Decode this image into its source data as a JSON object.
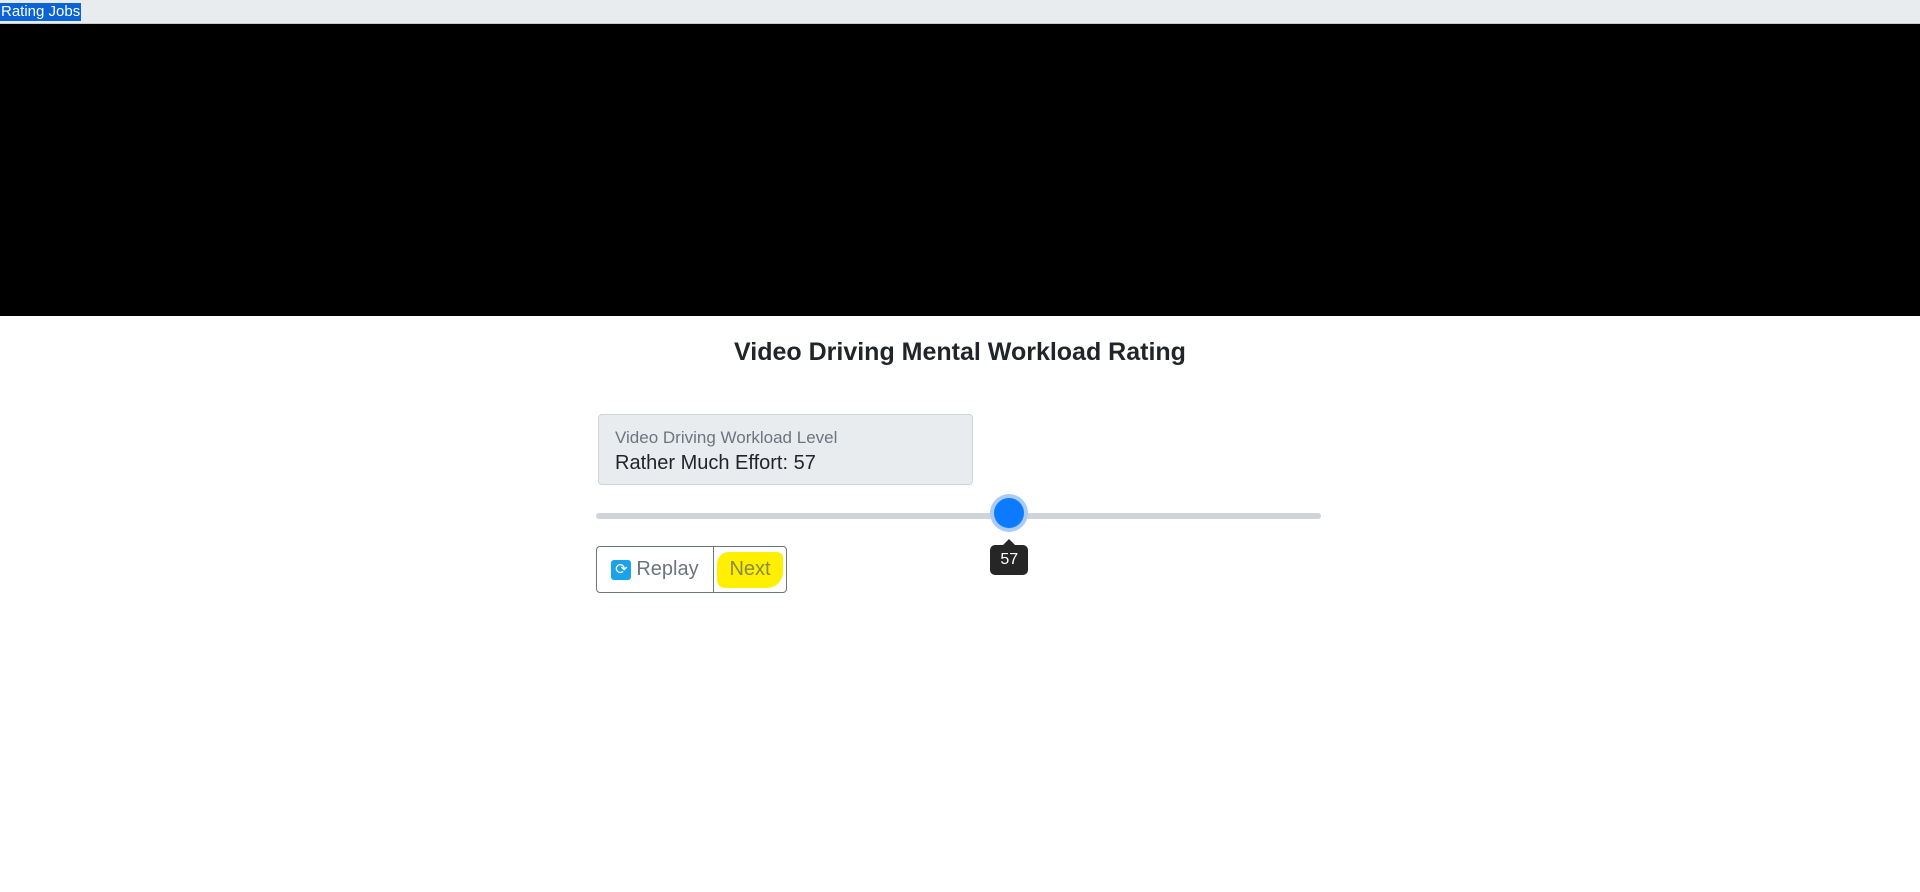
{
  "topbar": {
    "label": "Rating Jobs"
  },
  "page": {
    "title": "Video Driving Mental Workload Rating"
  },
  "level": {
    "label": "Video Driving Workload Level",
    "value_text": "Rather Much Effort: 57"
  },
  "slider": {
    "value": 57,
    "min": 0,
    "max": 100,
    "tooltip": "57"
  },
  "buttons": {
    "replay_label": "Replay",
    "replay_icon": "replay-icon",
    "next_label": "Next"
  },
  "colors": {
    "accent": "#0d7bff",
    "highlight": "#ffef00",
    "video_bg": "#000000"
  }
}
